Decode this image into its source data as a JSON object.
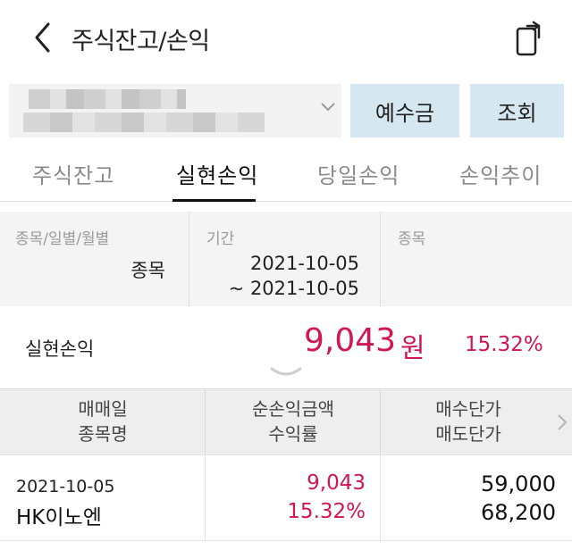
{
  "header": {
    "title": "주식잔고/손익"
  },
  "account": {
    "masked_line1": "",
    "masked_line2": ""
  },
  "buttons": {
    "deposit": "예수금",
    "query": "조회"
  },
  "tabs": [
    {
      "label": "주식잔고"
    },
    {
      "label": "실현손익"
    },
    {
      "label": "당일손익"
    },
    {
      "label": "손익추이"
    }
  ],
  "active_tab": "실현손익",
  "filters": {
    "mode_label": "종목/일별/월별",
    "mode_value": "종목",
    "period_label": "기간",
    "period_start": "2021-10-05",
    "period_end": "~ 2021-10-05",
    "stock_label": "종목"
  },
  "summary": {
    "label": "실현손익",
    "amount": "9,043",
    "unit": "원",
    "rate": "15.32%"
  },
  "table": {
    "headers": {
      "col1_line1": "매매일",
      "col1_line2": "종목명",
      "col2_line1": "순손익금액",
      "col2_line2": "수익률",
      "col3_line1": "매수단가",
      "col3_line2": "매도단가"
    },
    "rows": [
      {
        "date": "2021-10-05",
        "name": "HK이노엔",
        "net_pl": "9,043",
        "rate": "15.32%",
        "buy_price": "59,000",
        "sell_price": "68,200"
      }
    ]
  },
  "colors": {
    "accent_red": "#d11656",
    "button_bg": "#d5e7f0"
  },
  "icons": [
    "back-arrow-icon",
    "share-icon",
    "chevron-down-icon",
    "chevron-right-icon"
  ]
}
